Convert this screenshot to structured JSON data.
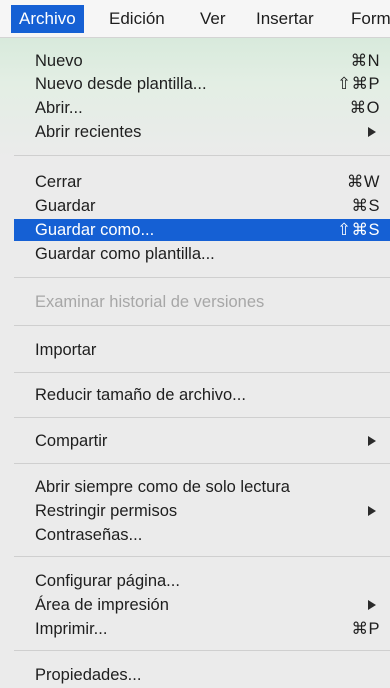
{
  "menubar": {
    "items": [
      {
        "label": "Archivo"
      },
      {
        "label": "Edición"
      },
      {
        "label": "Ver"
      },
      {
        "label": "Insertar"
      },
      {
        "label": "Form"
      }
    ]
  },
  "menu": {
    "nuevo": {
      "label": "Nuevo",
      "shortcut": "⌘N"
    },
    "nuevo_plantilla": {
      "label": "Nuevo desde plantilla...",
      "shortcut": "⇧⌘P"
    },
    "abrir": {
      "label": "Abrir...",
      "shortcut": "⌘O"
    },
    "abrir_recientes": {
      "label": "Abrir recientes"
    },
    "cerrar": {
      "label": "Cerrar",
      "shortcut": "⌘W"
    },
    "guardar": {
      "label": "Guardar",
      "shortcut": "⌘S"
    },
    "guardar_como": {
      "label": "Guardar como...",
      "shortcut": "⇧⌘S"
    },
    "guardar_plantilla": {
      "label": "Guardar como plantilla..."
    },
    "historial": {
      "label": "Examinar historial de versiones"
    },
    "importar": {
      "label": "Importar"
    },
    "reducir": {
      "label": "Reducir tamaño de archivo..."
    },
    "compartir": {
      "label": "Compartir"
    },
    "solo_lectura": {
      "label": "Abrir siempre como de solo lectura"
    },
    "restringir": {
      "label": "Restringir permisos"
    },
    "contrasenas": {
      "label": "Contraseñas..."
    },
    "configurar": {
      "label": "Configurar página..."
    },
    "area": {
      "label": "Área de impresión"
    },
    "imprimir": {
      "label": "Imprimir...",
      "shortcut": "⌘P"
    },
    "propiedades": {
      "label": "Propiedades..."
    }
  },
  "colors": {
    "highlight": "#1560d4",
    "disabled_text": "#a7a7a7"
  }
}
